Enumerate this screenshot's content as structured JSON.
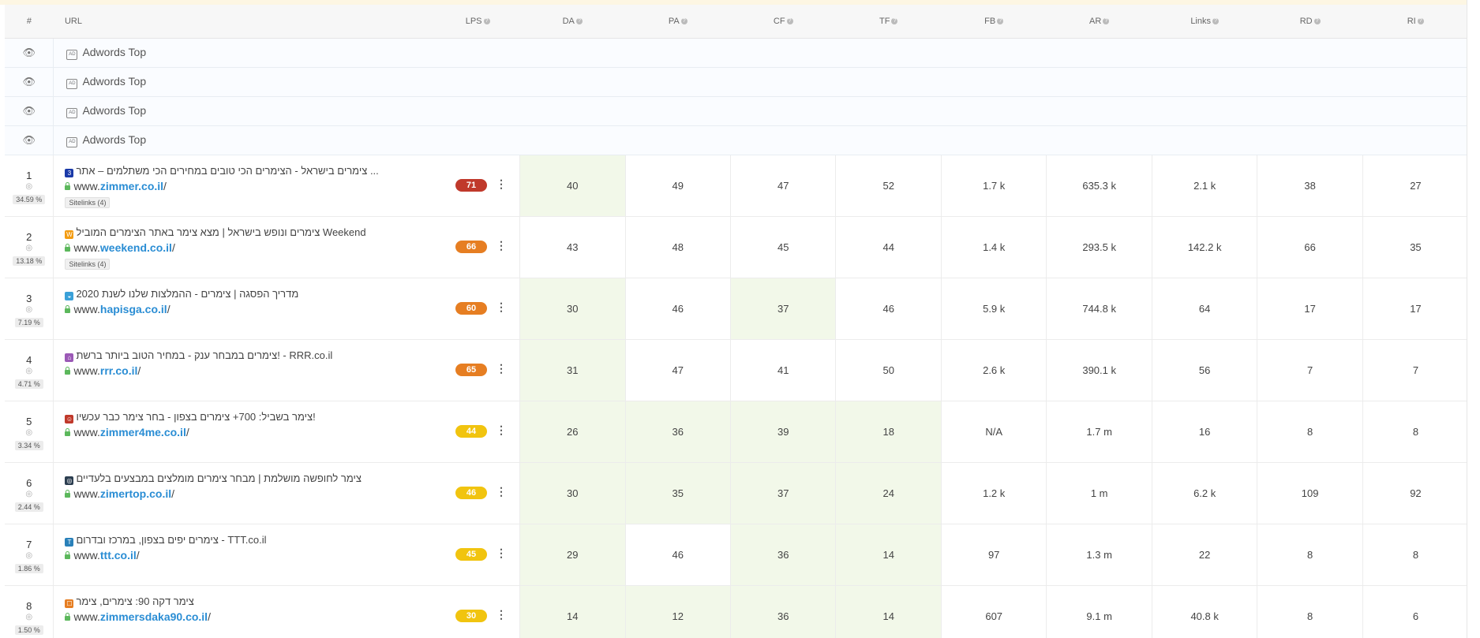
{
  "columns": {
    "num": "#",
    "url": "URL",
    "lps": "LPS",
    "da": "DA",
    "pa": "PA",
    "cf": "CF",
    "tf": "TF",
    "fb": "FB",
    "ar": "AR",
    "links": "Links",
    "rd": "RD",
    "ri": "RI"
  },
  "help_glyph": "?",
  "ads": [
    {
      "label": "Adwords Top",
      "badge": "AD"
    },
    {
      "label": "Adwords Top",
      "badge": "AD"
    },
    {
      "label": "Adwords Top",
      "badge": "AD"
    },
    {
      "label": "Adwords Top",
      "badge": "AD"
    }
  ],
  "rows": [
    {
      "rank": "1",
      "share": "34.59 %",
      "favicon": {
        "glyph": "3",
        "color": "#1a3aa8"
      },
      "title": "צימרים בישראל - הצימרים הכי טובים במחירים הכי משתלמים – אתר ...",
      "url": {
        "prefix": "www.",
        "domain": "zimmer.co.il",
        "suffix": "/"
      },
      "sitelinks": "Sitelinks (4)",
      "lps": "71",
      "lps_color": "#c0392b",
      "da": "40",
      "pa": "49",
      "cf": "47",
      "tf": "52",
      "fb": "1.7 k",
      "ar": "635.3 k",
      "links": "2.1 k",
      "rd": "38",
      "ri": "27",
      "highlights": [
        "da"
      ]
    },
    {
      "rank": "2",
      "share": "13.18 %",
      "favicon": {
        "glyph": "W",
        "color": "#f39c12"
      },
      "title": "צימרים ונופש בישראל | מצא צימר באתר הצימרים המוביל Weekend",
      "url": {
        "prefix": "www.",
        "domain": "weekend.co.il",
        "suffix": "/"
      },
      "sitelinks": "Sitelinks (4)",
      "lps": "66",
      "lps_color": "#e67e22",
      "da": "43",
      "pa": "48",
      "cf": "45",
      "tf": "44",
      "fb": "1.4 k",
      "ar": "293.5 k",
      "links": "142.2 k",
      "rd": "66",
      "ri": "35",
      "highlights": []
    },
    {
      "rank": "3",
      "share": "7.19 %",
      "favicon": {
        "glyph": "◒",
        "color": "#3aa0d8"
      },
      "title": "מדריך הפסגה | צימרים - ההמלצות שלנו לשנת 2020",
      "url": {
        "prefix": "www.",
        "domain": "hapisga.co.il",
        "suffix": "/"
      },
      "sitelinks": "",
      "lps": "60",
      "lps_color": "#e67e22",
      "da": "30",
      "pa": "46",
      "cf": "37",
      "tf": "46",
      "fb": "5.9 k",
      "ar": "744.8 k",
      "links": "64",
      "rd": "17",
      "ri": "17",
      "highlights": [
        "da",
        "cf"
      ]
    },
    {
      "rank": "4",
      "share": "4.71 %",
      "favicon": {
        "glyph": "⌂",
        "color": "#9b59b6"
      },
      "title": "צימרים במבחר ענק - במחיר הטוב ביותר ברשת! - RRR.co.il",
      "url": {
        "prefix": "www.",
        "domain": "rrr.co.il",
        "suffix": "/"
      },
      "sitelinks": "",
      "lps": "65",
      "lps_color": "#e67e22",
      "da": "31",
      "pa": "47",
      "cf": "41",
      "tf": "50",
      "fb": "2.6 k",
      "ar": "390.1 k",
      "links": "56",
      "rd": "7",
      "ri": "7",
      "highlights": [
        "da"
      ]
    },
    {
      "rank": "5",
      "share": "3.34 %",
      "favicon": {
        "glyph": "☺",
        "color": "#c0392b"
      },
      "title": "צימר בשביל: 700+ צימרים בצפון - בחר צימר כבר עכשיו!",
      "url": {
        "prefix": "www.",
        "domain": "zimmer4me.co.il",
        "suffix": "/"
      },
      "sitelinks": "",
      "lps": "44",
      "lps_color": "#f1c40f",
      "da": "26",
      "pa": "36",
      "cf": "39",
      "tf": "18",
      "fb": "N/A",
      "ar": "1.7 m",
      "links": "16",
      "rd": "8",
      "ri": "8",
      "highlights": [
        "da",
        "pa",
        "cf",
        "tf"
      ]
    },
    {
      "rank": "6",
      "share": "2.44 %",
      "favicon": {
        "glyph": "◎",
        "color": "#2c3e50"
      },
      "title": "צימר לחופשה מושלמת | מבחר צימרים מומלצים במבצעים בלעדיים",
      "url": {
        "prefix": "www.",
        "domain": "zimertop.co.il",
        "suffix": "/"
      },
      "sitelinks": "",
      "lps": "46",
      "lps_color": "#f1c40f",
      "da": "30",
      "pa": "35",
      "cf": "37",
      "tf": "24",
      "fb": "1.2 k",
      "ar": "1 m",
      "links": "6.2 k",
      "rd": "109",
      "ri": "92",
      "highlights": [
        "da",
        "pa",
        "cf",
        "tf"
      ]
    },
    {
      "rank": "7",
      "share": "1.86 %",
      "favicon": {
        "glyph": "T",
        "color": "#2980b9"
      },
      "title": "צימרים יפים בצפון, במרכז ובדרום - TTT.co.il",
      "url": {
        "prefix": "www.",
        "domain": "ttt.co.il",
        "suffix": "/"
      },
      "sitelinks": "",
      "lps": "45",
      "lps_color": "#f1c40f",
      "da": "29",
      "pa": "46",
      "cf": "36",
      "tf": "14",
      "fb": "97",
      "ar": "1.3 m",
      "links": "22",
      "rd": "8",
      "ri": "8",
      "highlights": [
        "da",
        "cf",
        "tf"
      ]
    },
    {
      "rank": "8",
      "share": "1.50 %",
      "favicon": {
        "glyph": "☐",
        "color": "#e67e22"
      },
      "title": "צימר דקה 90: צימרים, צימר",
      "url": {
        "prefix": "www.",
        "domain": "zimmersdaka90.co.il",
        "suffix": "/"
      },
      "sitelinks": "",
      "lps": "30",
      "lps_color": "#f1c40f",
      "da": "14",
      "pa": "12",
      "cf": "36",
      "tf": "14",
      "fb": "607",
      "ar": "9.1 m",
      "links": "40.8 k",
      "rd": "8",
      "ri": "6",
      "highlights": [
        "da",
        "pa",
        "cf",
        "tf"
      ]
    }
  ]
}
